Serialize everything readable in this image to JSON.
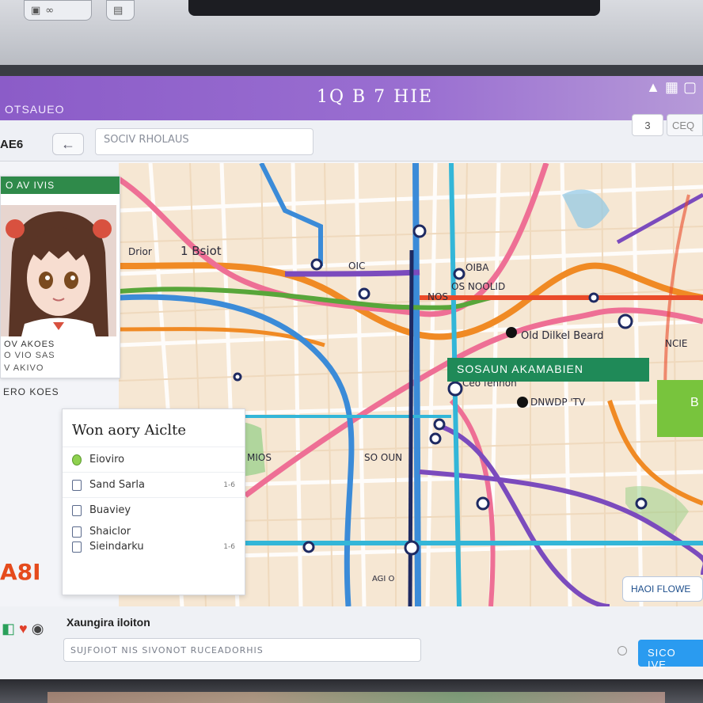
{
  "bezel": {
    "chip_left_icons": [
      "folder-icon",
      "link-icon"
    ],
    "chip_right_icon": "window-icon"
  },
  "titlebar": {
    "app_name": "OTSAUEO",
    "center_title": "1Q B 7 HIE",
    "right_icons": [
      "bookmark-icon",
      "share-icon",
      "window-icon"
    ]
  },
  "toolbar": {
    "brand": "AE6",
    "back_label": "←",
    "search_placeholder": "SOCIV RHOLAUS",
    "zoom_value": "3",
    "right_box": "CEQ"
  },
  "profile": {
    "header": "O AV IVIS",
    "name": "OV AKOES",
    "sub1": "O VIO SAS",
    "sub2": "V AKIVO",
    "footer": "ERO KOES"
  },
  "legend": {
    "title": "Won aory Aiclte",
    "items": [
      {
        "label": "Eioviro",
        "num": "",
        "checked": true
      },
      {
        "label": "Sand Sarla",
        "num": "1-6",
        "checked": false
      },
      {
        "label": "Buaviey",
        "num": "",
        "checked": false
      },
      {
        "label": "Shaiclor",
        "num": "",
        "checked": false
      },
      {
        "label": "Sieindarku",
        "num": "1-6",
        "checked": false
      }
    ]
  },
  "map": {
    "labels": [
      {
        "id": "label-1",
        "text": "Drior"
      },
      {
        "id": "label-2",
        "text": "1 Bsiot"
      },
      {
        "id": "label-3",
        "text": "OIC"
      },
      {
        "id": "label-4",
        "text": "OIBA"
      },
      {
        "id": "label-5",
        "text": "OS NOOLID"
      },
      {
        "id": "label-6",
        "text": "NOS"
      },
      {
        "id": "label-7",
        "text": "Old Dilkel Beard"
      },
      {
        "id": "label-8",
        "text": "Ceo fennon"
      },
      {
        "id": "label-9",
        "text": "DNWDP 'TV"
      },
      {
        "id": "label-10",
        "text": "SO OUN"
      },
      {
        "id": "label-11",
        "text": "AGI O"
      },
      {
        "id": "label-12",
        "text": "MIOS"
      },
      {
        "id": "label-13",
        "text": "NCIE"
      }
    ],
    "highlight_label": "SOSAUN AKAMABIEN",
    "side_tag": "B",
    "button_label": "HAOI FLOWE",
    "line_colors": {
      "orange": "#f08a24",
      "pink": "#ee6f95",
      "blue": "#3b8bd8",
      "purple": "#7b4bbd",
      "green": "#58a63a",
      "cyan": "#33b6d8",
      "red": "#ea4b2a",
      "navy": "#1e2a62"
    }
  },
  "red_badge": "A8I",
  "footer": {
    "icons": [
      "palette-icon",
      "heart-icon",
      "target-icon"
    ],
    "heading": "Xaungira iloiton",
    "field_value": "SUJFOIOT NIS SIVONOT RUCEADORHIS",
    "button_label": "SICO IVE"
  },
  "colors": {
    "titlebar": "#8b5cc8",
    "profile_header": "#2f8a4a",
    "highlight": "#1f8a58",
    "side_tag": "#78c43d",
    "button": "#2a9bf0",
    "map_bg": "#f6e7d3"
  }
}
